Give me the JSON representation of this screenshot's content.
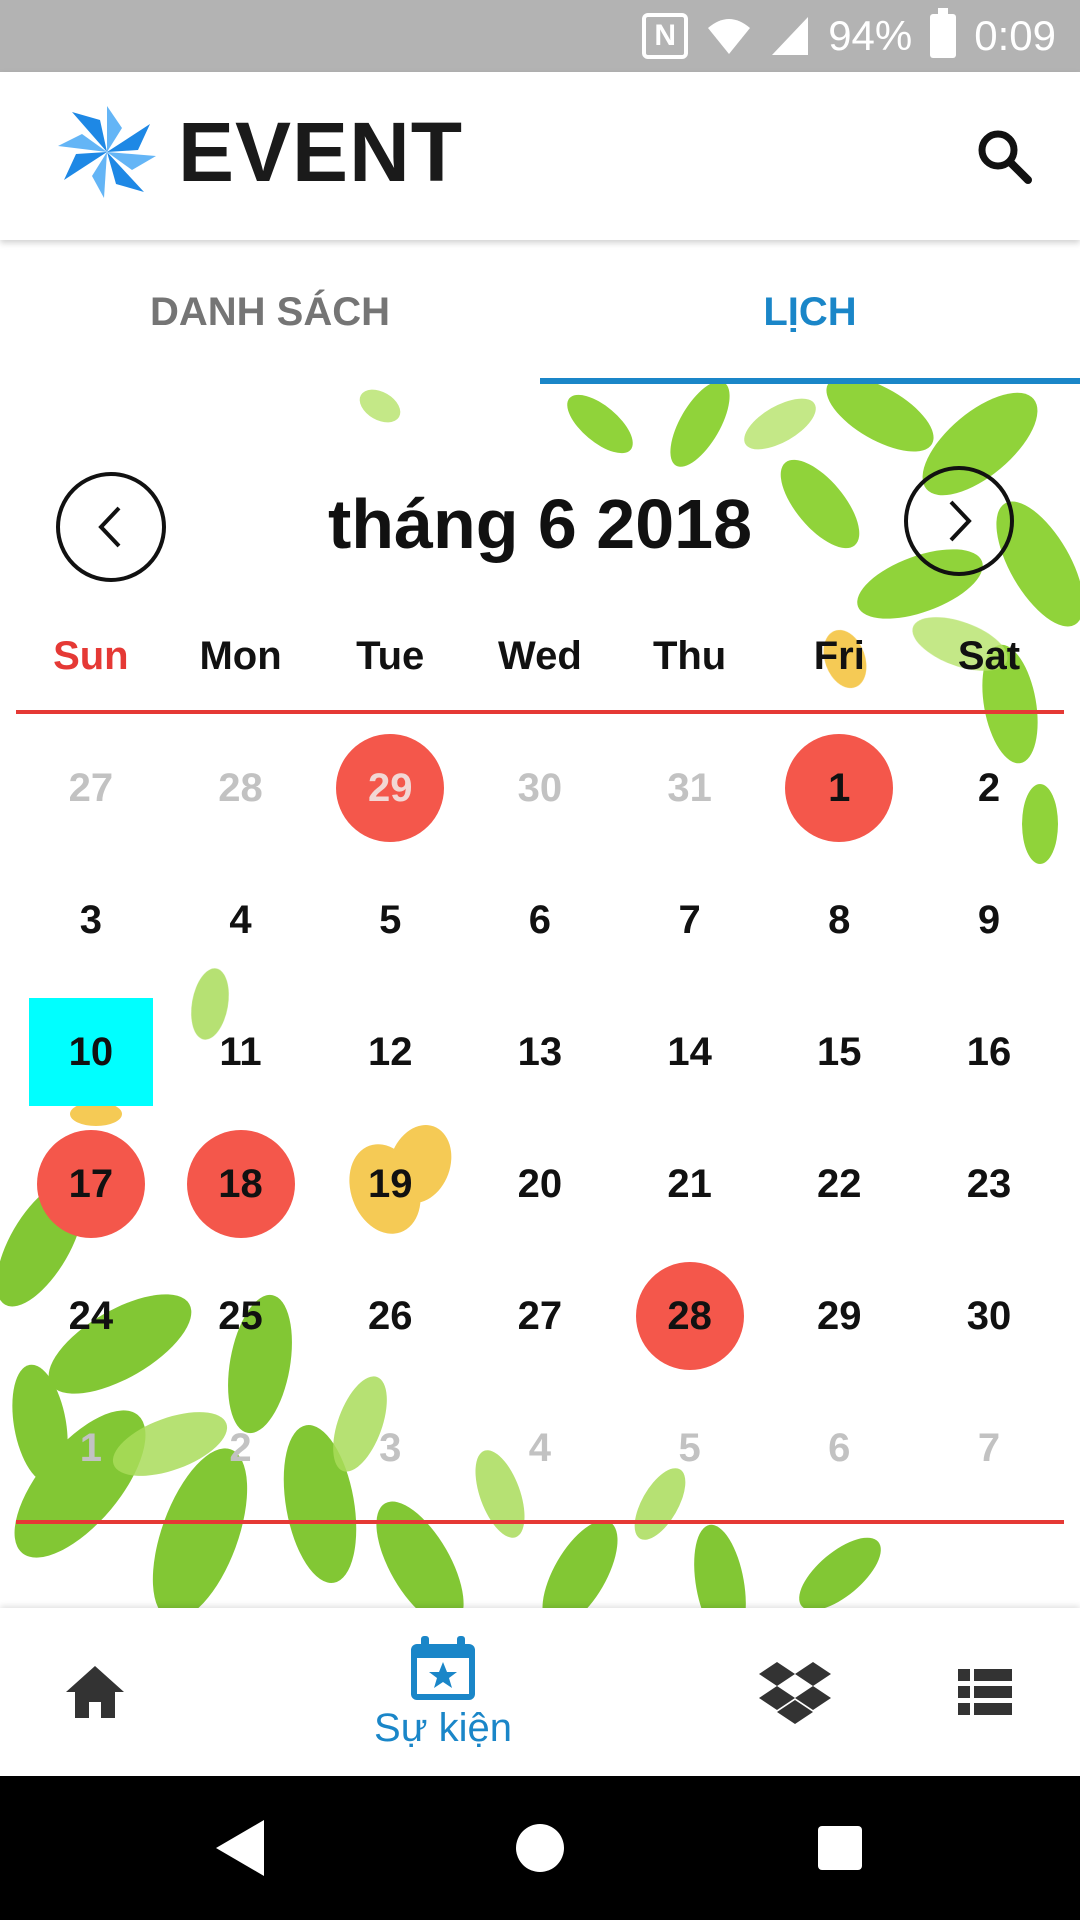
{
  "status_bar": {
    "battery": "94%",
    "time": "0:09",
    "icons": [
      "nfc-icon",
      "wifi-icon",
      "signal-icon",
      "battery-icon"
    ]
  },
  "header": {
    "logo_text": "EVENT",
    "search_icon": "search-icon"
  },
  "tabs": [
    {
      "label": "DANH SÁCH",
      "active": false
    },
    {
      "label": "LỊCH",
      "active": true
    }
  ],
  "calendar": {
    "month_label": "tháng 6 2018",
    "prev_icon": "chevron-left-icon",
    "next_icon": "chevron-right-icon",
    "weekdays": [
      "Sun",
      "Mon",
      "Tue",
      "Wed",
      "Thu",
      "Fri",
      "Sat"
    ],
    "weeks": [
      [
        {
          "d": "27",
          "other": true
        },
        {
          "d": "28",
          "other": true
        },
        {
          "d": "29",
          "other": true,
          "event": true
        },
        {
          "d": "30",
          "other": true
        },
        {
          "d": "31",
          "other": true
        },
        {
          "d": "1",
          "event": true
        },
        {
          "d": "2"
        }
      ],
      [
        {
          "d": "3"
        },
        {
          "d": "4"
        },
        {
          "d": "5"
        },
        {
          "d": "6"
        },
        {
          "d": "7"
        },
        {
          "d": "8"
        },
        {
          "d": "9"
        }
      ],
      [
        {
          "d": "10",
          "today": true
        },
        {
          "d": "11"
        },
        {
          "d": "12"
        },
        {
          "d": "13"
        },
        {
          "d": "14"
        },
        {
          "d": "15"
        },
        {
          "d": "16"
        }
      ],
      [
        {
          "d": "17",
          "event": true
        },
        {
          "d": "18",
          "event": true
        },
        {
          "d": "19"
        },
        {
          "d": "20"
        },
        {
          "d": "21"
        },
        {
          "d": "22"
        },
        {
          "d": "23"
        }
      ],
      [
        {
          "d": "24"
        },
        {
          "d": "25"
        },
        {
          "d": "26"
        },
        {
          "d": "27"
        },
        {
          "d": "28",
          "event": true
        },
        {
          "d": "29"
        },
        {
          "d": "30"
        }
      ],
      [
        {
          "d": "1",
          "other": true
        },
        {
          "d": "2",
          "other": true
        },
        {
          "d": "3",
          "other": true
        },
        {
          "d": "4",
          "other": true
        },
        {
          "d": "5",
          "other": true
        },
        {
          "d": "6",
          "other": true
        },
        {
          "d": "7",
          "other": true
        }
      ]
    ],
    "colors": {
      "event": "#f4574b",
      "today": "#00ffff",
      "sunday": "#e53935",
      "rule": "#e53935",
      "other_month": "#c2c2c2"
    }
  },
  "bottom_nav": {
    "items": [
      {
        "icon": "home-icon",
        "label": ""
      },
      {
        "icon": "calendar-star-icon",
        "label": "Sự kiện",
        "active": true
      },
      {
        "icon": "dropbox-icon",
        "label": ""
      },
      {
        "icon": "list-icon",
        "label": ""
      }
    ],
    "accent": "#1a86c8"
  },
  "system_nav": {
    "icons": [
      "back-icon",
      "home-circle-icon",
      "recents-icon"
    ]
  }
}
